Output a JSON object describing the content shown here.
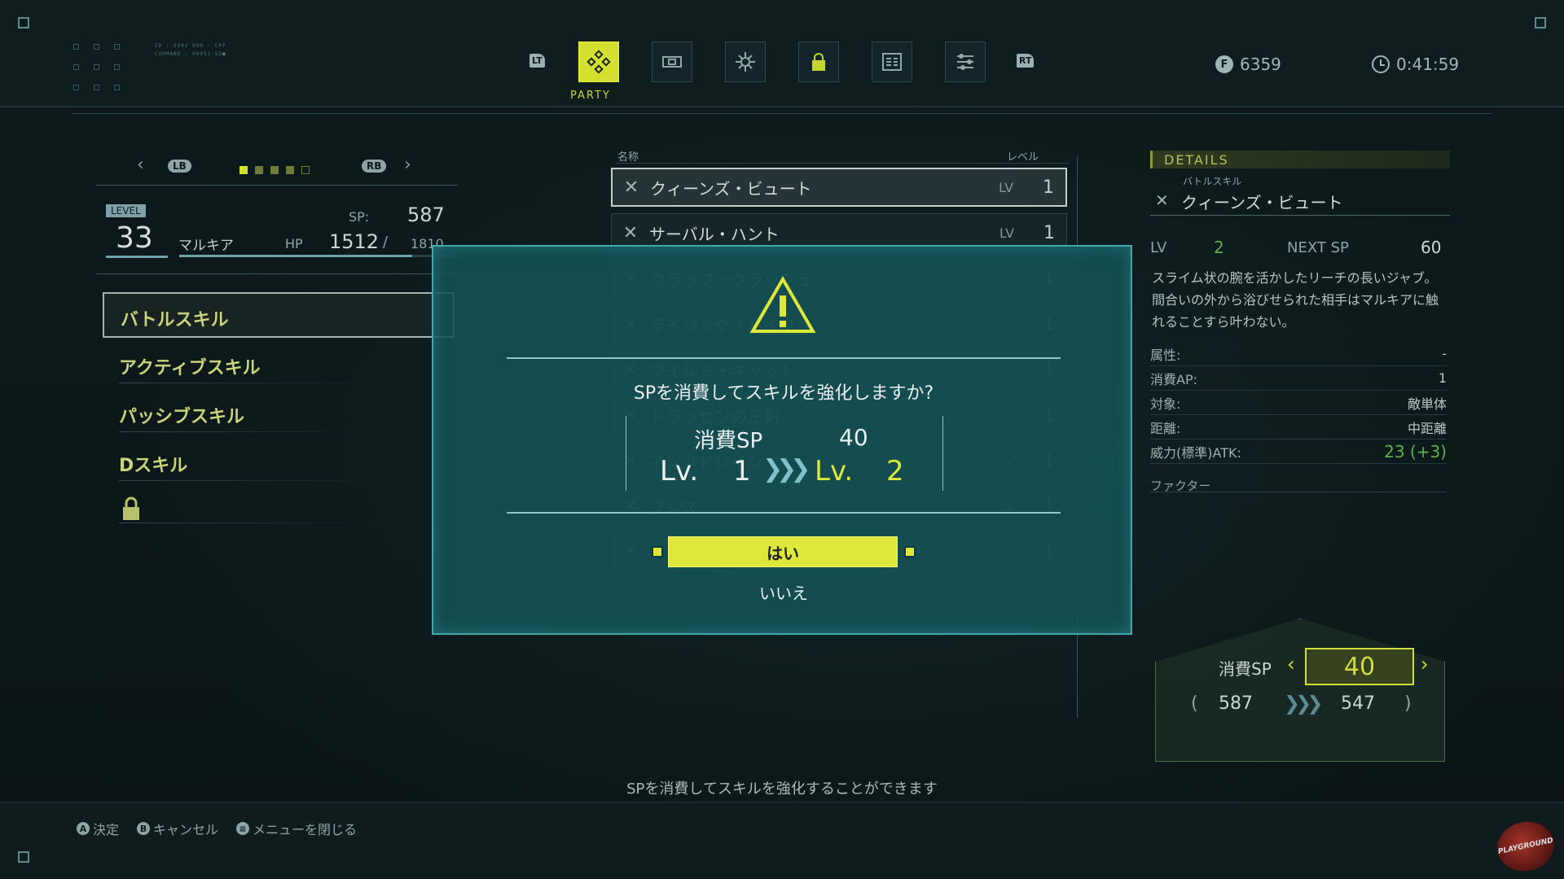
{
  "top_bar": {
    "debug_line1": "ID : 5002 00H · CPP",
    "debug_line2": "COMMAND : 00052-55■",
    "lt_label": "LT",
    "rt_label": "RT",
    "tabs": [
      {
        "icon": "party-icon",
        "label": "PARTY",
        "active": true
      },
      {
        "icon": "equipment-icon",
        "active": false
      },
      {
        "icon": "skill-tree-icon",
        "active": false
      },
      {
        "icon": "lock-icon",
        "active": false
      },
      {
        "icon": "document-icon",
        "active": false
      },
      {
        "icon": "settings-list-icon",
        "active": false
      }
    ],
    "currency_value": "6359",
    "play_time": "0:41:59"
  },
  "character": {
    "lb_label": "LB",
    "rb_label": "RB",
    "page_count": 5,
    "page_active": 1,
    "level_label": "LEVEL",
    "level_value": "33",
    "name": "マルキア",
    "sp_label": "SP:",
    "sp_value": "587",
    "hp_label": "HP",
    "hp_current": "1512",
    "hp_sep": "/",
    "hp_max": "1810",
    "hp_fraction": 0.835
  },
  "categories": [
    "バトルスキル",
    "アクティブスキル",
    "パッシブスキル",
    "Dスキル"
  ],
  "skill_list": {
    "header_name": "名称",
    "header_level": "レベル",
    "lv_label": "LV",
    "rows": [
      {
        "name": "クィーンズ・ビュート",
        "level": "1"
      },
      {
        "name": "サーバル・ハント",
        "level": "1"
      },
      {
        "name": "クラップ・クラッシュ",
        "level": "1"
      },
      {
        "name": "ライジング・パイソン",
        "level": "1"
      },
      {
        "name": "ワイルド・キャット",
        "level": "1"
      },
      {
        "name": "トラッセンの王剣",
        "level": "1"
      },
      {
        "name": "アシッドレイン",
        "level": "1"
      },
      {
        "name": "ブレス",
        "level": "1"
      },
      {
        "name": "",
        "level": "1"
      }
    ]
  },
  "details": {
    "header": "DETAILS",
    "category": "バトルスキル",
    "skill_name": "クィーンズ・ビュート",
    "lv_label": "LV",
    "lv_value": "2",
    "next_sp_label": "NEXT SP",
    "next_sp_value": "60",
    "description": "スライム状の腕を活かしたリーチの長いジャブ。間合いの外から浴びせられた相手はマルキアに触れることすら叶わない。",
    "stats": [
      {
        "key": "属性:",
        "value": "-"
      },
      {
        "key": "消費AP:",
        "value": "1"
      },
      {
        "key": "対象:",
        "value": "敵単体"
      },
      {
        "key": "距離:",
        "value": "中距離"
      },
      {
        "key": "威力(標準)ATK:",
        "value": "23 (+3)"
      }
    ],
    "factor_label": "ファクター"
  },
  "modal": {
    "question": "SPを消費してスキルを強化しますか?",
    "cost_label": "消費SP",
    "cost_value": "40",
    "lv_prefix": "Lv.",
    "lv_from": "1",
    "lv_to": "2",
    "yes_label": "はい",
    "no_label": "いいえ"
  },
  "sp_panel": {
    "label": "消費SP",
    "value": "40",
    "from": "587",
    "to": "547",
    "open_paren": "(",
    "close_paren": ")"
  },
  "footer": {
    "help_text": "SPを消費してスキルを強化することができます",
    "hints": [
      {
        "glyph": "A",
        "label": "決定"
      },
      {
        "glyph": "B",
        "label": "キャンセル"
      },
      {
        "glyph": "≡",
        "label": "メニューを閉じる"
      }
    ],
    "watermark": "PLAYGROUND"
  },
  "colors": {
    "accent": "#dde83a",
    "modal_bg": "#155256",
    "green_value": "#5fb04a"
  }
}
